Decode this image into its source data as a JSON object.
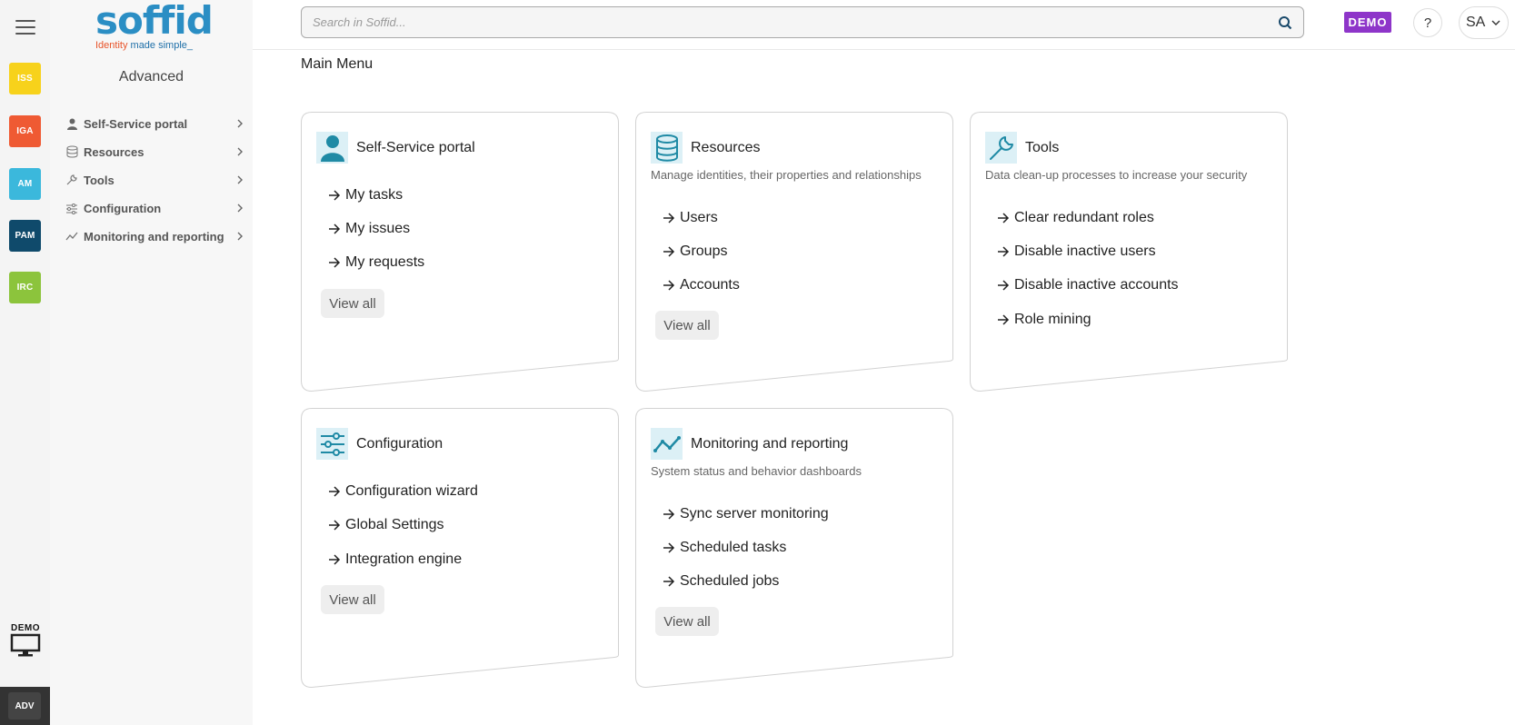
{
  "rail": {
    "apps": [
      {
        "label": "ISS",
        "color": "#f7d21b"
      },
      {
        "label": "IGA",
        "color": "#ef5a33"
      },
      {
        "label": "AM",
        "color": "#3bb8dc"
      },
      {
        "label": "PAM",
        "color": "#0f4a6b"
      },
      {
        "label": "IRC",
        "color": "#8cc43c"
      }
    ],
    "demo_label": "DEMO",
    "adv_label": "ADV"
  },
  "logo": {
    "word": "soffid",
    "tag_part1": "Identity",
    "tag_part2": " made simple_"
  },
  "sidebar": {
    "title": "Advanced",
    "items": [
      {
        "label": "Self-Service portal",
        "icon": "person-icon"
      },
      {
        "label": "Resources",
        "icon": "database-icon"
      },
      {
        "label": "Tools",
        "icon": "wrench-icon"
      },
      {
        "label": "Configuration",
        "icon": "sliders-icon"
      },
      {
        "label": "Monitoring and reporting",
        "icon": "chart-line-icon"
      }
    ]
  },
  "header": {
    "search_placeholder": "Search in Soffid...",
    "demo_badge": "DEMO",
    "help_label": "?",
    "user_initials": "SA"
  },
  "main": {
    "breadcrumb": "Main Menu",
    "cards": [
      {
        "title": "Self-Service portal",
        "icon": "person-icon",
        "description": "",
        "links": [
          "My tasks",
          "My issues",
          "My requests"
        ],
        "view_all": "View all"
      },
      {
        "title": "Resources",
        "icon": "database-icon",
        "description": "Manage identities, their properties and relationships",
        "links": [
          "Users",
          "Groups",
          "Accounts"
        ],
        "view_all": "View all"
      },
      {
        "title": "Tools",
        "icon": "wrench-icon",
        "description": "Data clean-up processes to increase your security",
        "links": [
          "Clear redundant roles",
          "Disable inactive users",
          "Disable inactive accounts",
          "Role mining"
        ],
        "view_all": ""
      },
      {
        "title": "Configuration",
        "icon": "sliders-icon",
        "description": "",
        "links": [
          "Configuration wizard",
          "Global Settings",
          "Integration engine"
        ],
        "view_all": "View all"
      },
      {
        "title": "Monitoring and reporting",
        "icon": "chart-line-icon",
        "description": "System status and behavior dashboards",
        "links": [
          "Sync server monitoring",
          "Scheduled tasks",
          "Scheduled jobs"
        ],
        "view_all": "View all"
      }
    ]
  }
}
